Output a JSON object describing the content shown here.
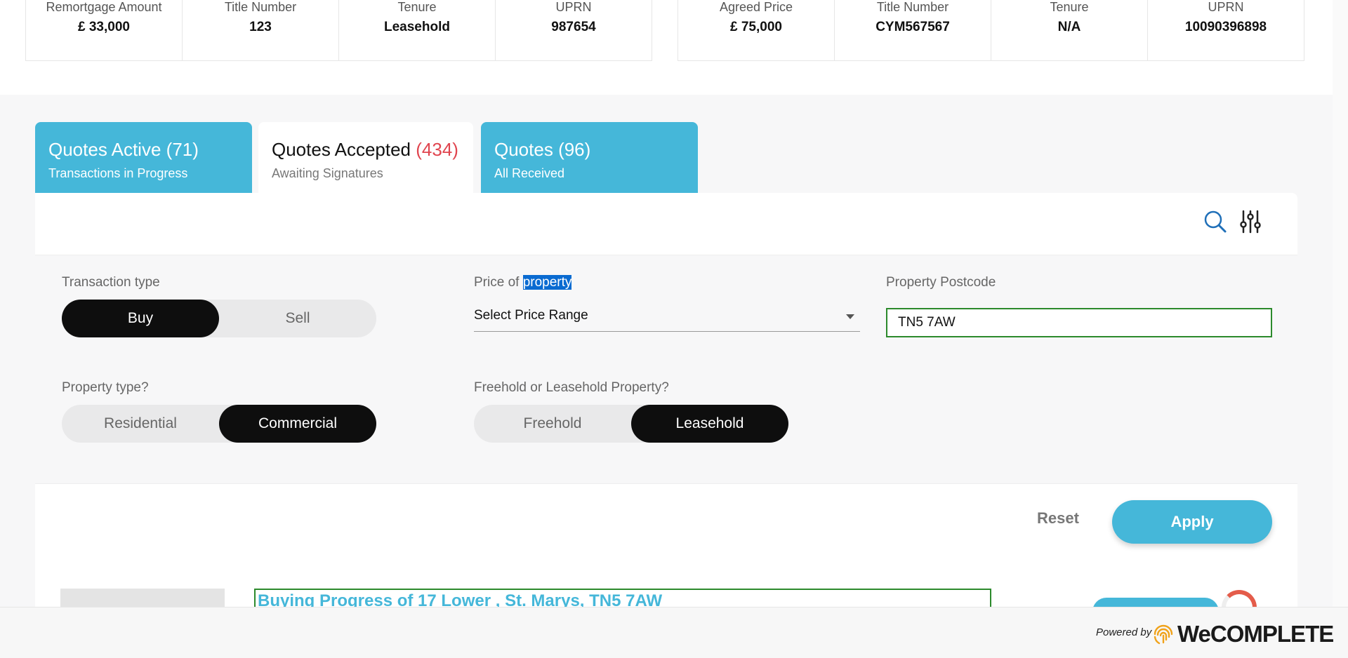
{
  "property_cards": {
    "left": [
      {
        "label": "Remortgage Amount",
        "value": "£ 33,000"
      },
      {
        "label": "Title Number",
        "value": "123"
      },
      {
        "label": "Tenure",
        "value": "Leasehold"
      },
      {
        "label": "UPRN",
        "value": "987654"
      }
    ],
    "right": [
      {
        "label": "Agreed Price",
        "value": "£ 75,000"
      },
      {
        "label": "Title Number",
        "value": "CYM567567"
      },
      {
        "label": "Tenure",
        "value": "N/A"
      },
      {
        "label": "UPRN",
        "value": "10090396898"
      }
    ]
  },
  "tabs": [
    {
      "title": "Quotes Active",
      "count": "(71)",
      "subtitle": "Transactions in Progress",
      "active": false
    },
    {
      "title": "Quotes Accepted",
      "count": "(434)",
      "subtitle": "Awaiting Signatures",
      "active": true
    },
    {
      "title": "Quotes",
      "count": "(96)",
      "subtitle": "All Received",
      "active": false
    }
  ],
  "icons": {
    "search": "search-icon",
    "filter": "sliders-icon"
  },
  "filters": {
    "transaction_type": {
      "label": "Transaction type",
      "options": [
        "Buy",
        "Sell"
      ],
      "selected": "Buy"
    },
    "price": {
      "label_prefix": "Price of ",
      "label_highlight": "property",
      "value": "Select Price Range"
    },
    "postcode": {
      "label": "Property Postcode",
      "value": "TN5 7AW"
    },
    "property_type": {
      "label": "Property type?",
      "options": [
        "Residential",
        "Commercial"
      ],
      "selected": "Commercial"
    },
    "tenure": {
      "label": "Freehold or Leasehold Property?",
      "options": [
        "Freehold",
        "Leasehold"
      ],
      "selected": "Leasehold"
    }
  },
  "actions": {
    "reset": "Reset",
    "apply": "Apply"
  },
  "list": {
    "first_title": "Buying Progress of 17 Lower , St. Marys, TN5 7AW"
  },
  "footer": {
    "powered_by": "Powered by",
    "brand": "WeCOMPLETE"
  },
  "colors": {
    "accent": "#45b7d9",
    "active_toggle": "#0e0e0e",
    "count_red": "#e0454f",
    "valid_border": "#2c8a2c"
  }
}
